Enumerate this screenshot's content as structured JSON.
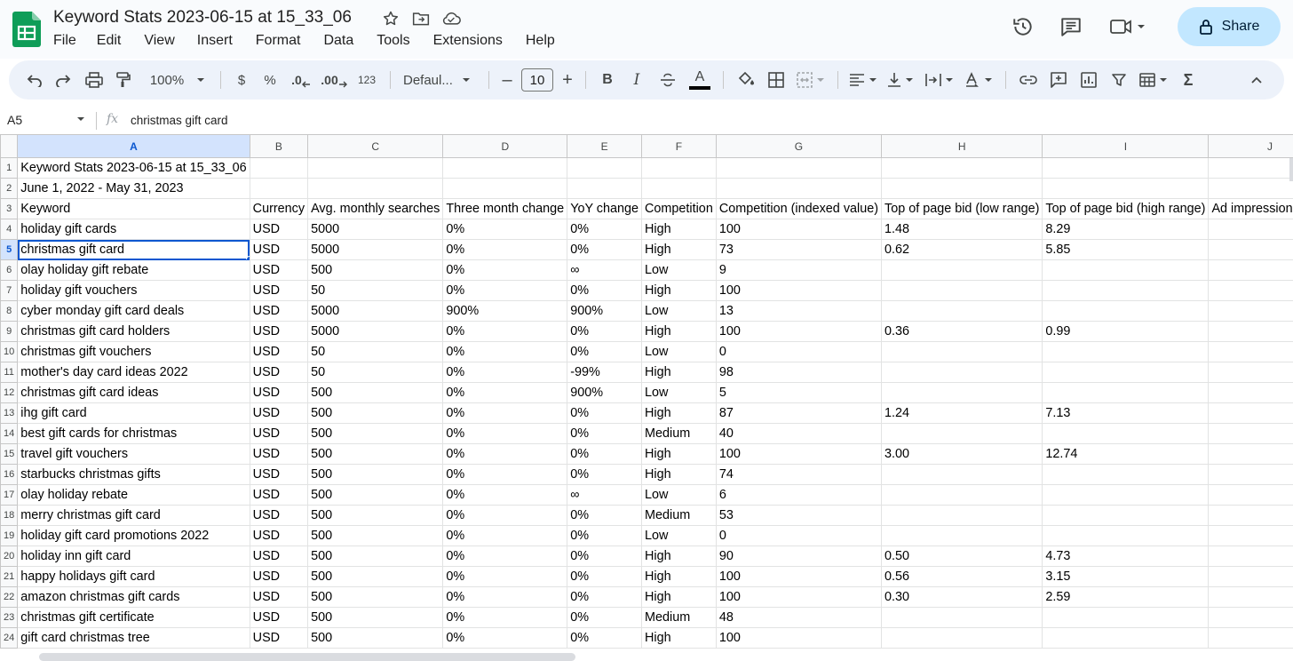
{
  "doc": {
    "title": "Keyword Stats 2023-06-15 at 15_33_06"
  },
  "menu": [
    "File",
    "Edit",
    "View",
    "Insert",
    "Format",
    "Data",
    "Tools",
    "Extensions",
    "Help"
  ],
  "share_label": "Share",
  "toolbar": {
    "zoom": "100%",
    "currency": "$",
    "percent": "%",
    "dec_decrease": ".0",
    "dec_increase": ".00",
    "number_format": "123",
    "font": "Defaul...",
    "font_size_minus": "–",
    "font_size": "10",
    "font_size_plus": "+",
    "bold": "B",
    "italic": "I",
    "text_color": "A",
    "functions": "Σ"
  },
  "formula_bar": {
    "cell_ref": "A5",
    "fx": "fx",
    "value": "christmas gift card"
  },
  "colors": {
    "accent": "#0b57d0",
    "share_bg": "#c2e7ff",
    "logo_green": "#0f9d58"
  },
  "sheet": {
    "columns": [
      "A",
      "B",
      "C",
      "D",
      "E",
      "F",
      "G",
      "H",
      "I",
      "J"
    ],
    "rows": [
      {
        "n": "1",
        "c": [
          "Keyword Stats 2023-06-15 at 15_33_06",
          "",
          "",
          "",
          "",
          "",
          "",
          "",
          "",
          ""
        ]
      },
      {
        "n": "2",
        "c": [
          "June 1, 2022 - May 31, 2023",
          "",
          "",
          "",
          "",
          "",
          "",
          "",
          "",
          ""
        ]
      },
      {
        "n": "3",
        "c": [
          "Keyword",
          "Currency",
          "Avg. monthly searches",
          "Three month change",
          "YoY change",
          "Competition",
          "Competition (indexed value)",
          "Top of page bid (low range)",
          "Top of page bid (high range)",
          "Ad impression share"
        ]
      },
      {
        "n": "4",
        "c": [
          "holiday gift cards",
          "USD",
          "5000",
          "0%",
          "0%",
          "High",
          "100",
          "1.48",
          "8.29",
          ""
        ]
      },
      {
        "n": "5",
        "c": [
          "christmas gift card",
          "USD",
          "5000",
          "0%",
          "0%",
          "High",
          "73",
          "0.62",
          "5.85",
          ""
        ]
      },
      {
        "n": "6",
        "c": [
          "olay holiday gift rebate",
          "USD",
          "500",
          "0%",
          "∞",
          "Low",
          "9",
          "",
          "",
          ""
        ]
      },
      {
        "n": "7",
        "c": [
          "holiday gift vouchers",
          "USD",
          "50",
          "0%",
          "0%",
          "High",
          "100",
          "",
          "",
          ""
        ]
      },
      {
        "n": "8",
        "c": [
          "cyber monday gift card deals",
          "USD",
          "5000",
          "900%",
          "900%",
          "Low",
          "13",
          "",
          "",
          ""
        ]
      },
      {
        "n": "9",
        "c": [
          "christmas gift card holders",
          "USD",
          "5000",
          "0%",
          "0%",
          "High",
          "100",
          "0.36",
          "0.99",
          ""
        ]
      },
      {
        "n": "10",
        "c": [
          "christmas gift vouchers",
          "USD",
          "50",
          "0%",
          "0%",
          "Low",
          "0",
          "",
          "",
          ""
        ]
      },
      {
        "n": "11",
        "c": [
          "mother's day card ideas 2022",
          "USD",
          "50",
          "0%",
          "-99%",
          "High",
          "98",
          "",
          "",
          ""
        ]
      },
      {
        "n": "12",
        "c": [
          "christmas gift card ideas",
          "USD",
          "500",
          "0%",
          "900%",
          "Low",
          "5",
          "",
          "",
          ""
        ]
      },
      {
        "n": "13",
        "c": [
          "ihg gift card",
          "USD",
          "500",
          "0%",
          "0%",
          "High",
          "87",
          "1.24",
          "7.13",
          ""
        ]
      },
      {
        "n": "14",
        "c": [
          "best gift cards for christmas",
          "USD",
          "500",
          "0%",
          "0%",
          "Medium",
          "40",
          "",
          "",
          ""
        ]
      },
      {
        "n": "15",
        "c": [
          "travel gift vouchers",
          "USD",
          "500",
          "0%",
          "0%",
          "High",
          "100",
          "3.00",
          "12.74",
          ""
        ]
      },
      {
        "n": "16",
        "c": [
          "starbucks christmas gifts",
          "USD",
          "500",
          "0%",
          "0%",
          "High",
          "74",
          "",
          "",
          ""
        ]
      },
      {
        "n": "17",
        "c": [
          "olay holiday rebate",
          "USD",
          "500",
          "0%",
          "∞",
          "Low",
          "6",
          "",
          "",
          ""
        ]
      },
      {
        "n": "18",
        "c": [
          "merry christmas gift card",
          "USD",
          "500",
          "0%",
          "0%",
          "Medium",
          "53",
          "",
          "",
          ""
        ]
      },
      {
        "n": "19",
        "c": [
          "holiday gift card promotions 2022",
          "USD",
          "500",
          "0%",
          "0%",
          "Low",
          "0",
          "",
          "",
          ""
        ]
      },
      {
        "n": "20",
        "c": [
          "holiday inn gift card",
          "USD",
          "500",
          "0%",
          "0%",
          "High",
          "90",
          "0.50",
          "4.73",
          ""
        ]
      },
      {
        "n": "21",
        "c": [
          "happy holidays gift card",
          "USD",
          "500",
          "0%",
          "0%",
          "High",
          "100",
          "0.56",
          "3.15",
          ""
        ]
      },
      {
        "n": "22",
        "c": [
          "amazon christmas gift cards",
          "USD",
          "500",
          "0%",
          "0%",
          "High",
          "100",
          "0.30",
          "2.59",
          ""
        ]
      },
      {
        "n": "23",
        "c": [
          "christmas gift certificate",
          "USD",
          "500",
          "0%",
          "0%",
          "Medium",
          "48",
          "",
          "",
          ""
        ]
      },
      {
        "n": "24",
        "c": [
          "gift card christmas tree",
          "USD",
          "500",
          "0%",
          "0%",
          "High",
          "100",
          "",
          "",
          ""
        ]
      }
    ]
  }
}
